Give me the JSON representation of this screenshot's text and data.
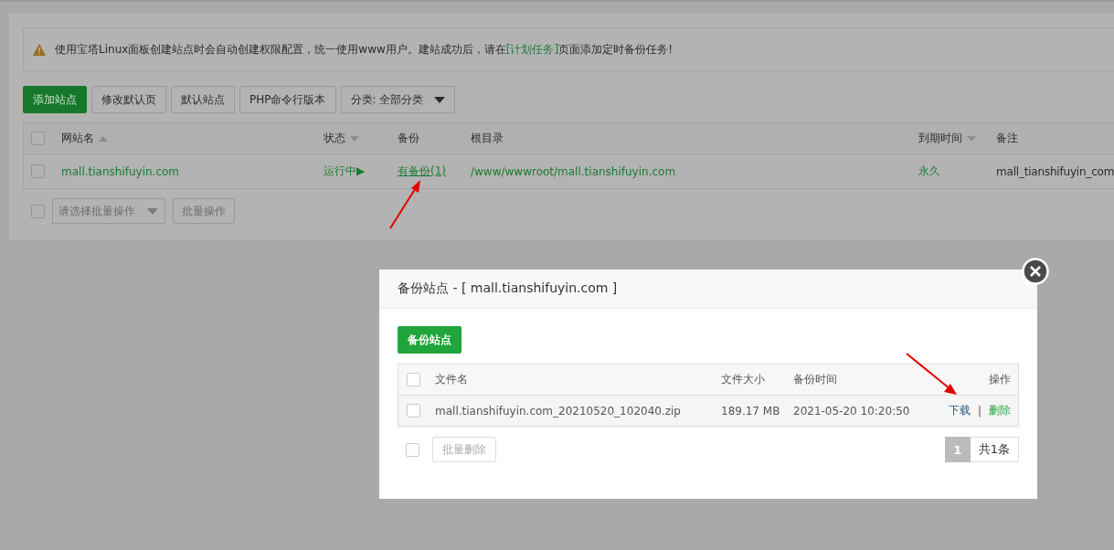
{
  "notice": {
    "before": "使用宝塔Linux面板创建站点时会自动创建权限配置，统一使用www用户。建站成功后，请在",
    "link": "[计划任务]",
    "after": "页面添加定时备份任务!"
  },
  "toolbar": [
    {
      "label": "添加站点",
      "kind": "primary"
    },
    {
      "label": "修改默认页",
      "kind": "default"
    },
    {
      "label": "默认站点",
      "kind": "default"
    },
    {
      "label": "PHP命令行版本",
      "kind": "default"
    },
    {
      "label": "分类: 全部分类",
      "kind": "dropdown"
    }
  ],
  "sites": {
    "select_all_checked": false,
    "columns": [
      {
        "label": "网站名",
        "sortable": true,
        "ascending": true
      },
      {
        "label": "状态",
        "sortable": true,
        "ascending": false
      },
      {
        "label": "备份"
      },
      {
        "label": "根目录"
      },
      {
        "label": "到期时间",
        "sortable": true,
        "ascending": false
      },
      {
        "label": "备注"
      }
    ],
    "rows": [
      {
        "checked": false,
        "name": "mall.tianshifuyin.com",
        "status": "运行中▶",
        "backup": "有备份(1)",
        "root": "/www/wwwroot/mall.tianshifuyin.com",
        "expire": "永久",
        "note": "mall_tianshifuyin_com"
      }
    ]
  },
  "batch": {
    "checked": false,
    "select": "请选择批量操作",
    "button": "批量操作",
    "disabled": true
  },
  "modal": {
    "title": "备份站点 - [ mall.tianshifuyin.com ]",
    "primary": "备份站点",
    "select_all_checked": false,
    "columns": [
      "文件名",
      "文件大小",
      "备份时间",
      "操作"
    ],
    "rows": [
      {
        "checked": false,
        "file": "mall.tianshifuyin.com_20210520_102040.zip",
        "size": "189.17 MB",
        "time": "2021-05-20 10:20:50",
        "separator": "|",
        "actions": [
          {
            "label": "下载",
            "kind": "download"
          },
          {
            "label": "删除",
            "kind": "delete"
          }
        ]
      }
    ],
    "footer_checked": false,
    "batch_delete": "批量删除",
    "batch_delete_disabled": true,
    "pages": [
      {
        "label": "1",
        "selected": true
      }
    ],
    "total": "共1条"
  }
}
